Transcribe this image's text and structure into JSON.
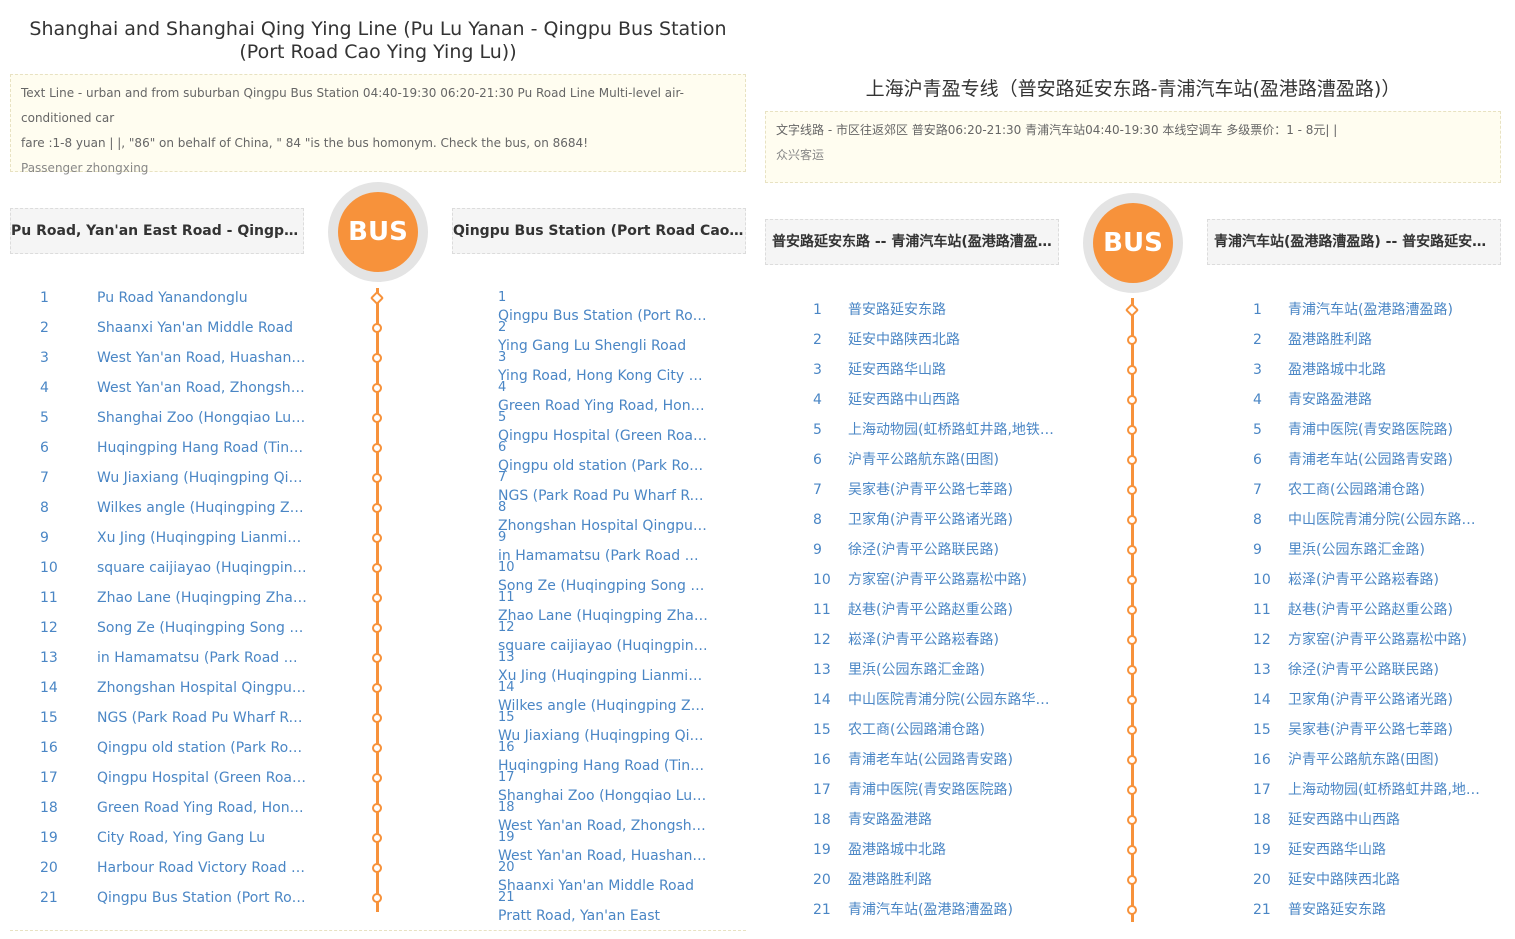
{
  "left": {
    "title": "Shanghai and Shanghai Qing Ying Line (Pu Lu Yanan - Qingpu Bus Station (Port Road Cao Ying Ying Lu))",
    "notice_line1": "Text Line - urban and from suburban Qingpu Bus Station 04:40-19:30 06:20-21:30 Pu Road Line Multi-level air-conditioned car",
    "notice_line2": "fare :1-8 yuan | |, \"86\" on behalf of China, \" 84 \"is the bus homonym.      Check the bus, on 8684!",
    "passenger": "Passenger zhongxing",
    "dir_left": "Pu Road, Yan'an East Road - Qingpu Bus Station (Port Road Cao Ying Ying Lu)",
    "dir_right": "Qingpu Bus Station (Port Road Cao Ying Ying Lu) - Pu Road, Yan'an East Road",
    "bus_label": "BUS",
    "stops_forward": [
      "Pu Road Yanandonglu",
      "Shaanxi Yan'an Middle Road",
      "West Yan'an Road, Huashan Road",
      "West Yan'an Road, Zhongshan West Road",
      "Shanghai Zoo (Hongqiao Lu Hongjing Road)",
      "Huqingping Hang Road (Tin Field Map)",
      "Wu Jiaxiang (Huqingping Qixin)",
      "Wilkes angle (Huqingping Zhuguang Road)",
      "Xu Jing (Huqingping Lianmin Road)",
      "square caijiayao (Huqingping Jiasong Road)",
      "Zhao Lane (Huqingping Zhao road)",
      "Song Ze (Huqingping Song Spring Road)",
      "in Hamamatsu (Park Road Huijin Road)",
      "Zhongshan Hospital Qingpu Branch",
      "NGS (Park Road Pu Wharf Road)",
      "Qingpu old station (Park Road Qing An Road)",
      "Qingpu Hospital (Green Road Qing An Road)",
      "Green Road Ying Road, Hong Kong City",
      "City Road, Ying Gang Lu",
      "Harbour Road Victory Road surrounding",
      "Qingpu Bus Station (Port Road Cao Ying Ying Lu)"
    ],
    "stops_reverse": [
      "Qingpu Bus Station (Port Road Cao Ying Ying Lu)",
      "Ying Gang Lu Shengli Road",
      "Ying Road, Hong Kong City North",
      "Green Road Ying Road, Hong Kong City",
      "Qingpu Hospital (Green Road Qing An Road)",
      "Qingpu old station (Park Road Qing An Road)",
      "NGS (Park Road Pu Wharf Road)",
      "Zhongshan Hospital Qingpu Branch",
      "in Hamamatsu (Park Road Huijin Road)",
      "Song Ze (Huqingping Song Spring Road)",
      "Zhao Lane (Huqingping Zhao road)",
      "square caijiayao (Huqingping Jiasong Road)",
      "Xu Jing (Huqingping Lianmin Road)",
      "Wilkes angle (Huqingping Zhuguang Road)",
      "Wu Jiaxiang (Huqingping Qixin)",
      "Huqingping Hang Road (Tin Field Map)",
      "Shanghai Zoo (Hongqiao Lu Hongjing Road)",
      "West Yan'an Road, Zhongshan West Road",
      "West Yan'an Road, Huashan Road",
      "Shaanxi Yan'an Middle Road",
      "Pratt Road, Yan'an East"
    ]
  },
  "right": {
    "title": "上海沪青盈专线（普安路延安东路-青浦汽车站(盈港路漕盈路)）",
    "notice_line1": "文字线路 - 市区往返郊区 普安路06:20-21:30 青浦汽车站04:40-19:30 本线空调车 多级票价：1 - 8元| |",
    "passenger": "众兴客运",
    "dir_left": "普安路延安东路 -- 青浦汽车站(盈港路漕盈路)",
    "dir_right": "青浦汽车站(盈港路漕盈路) -- 普安路延安东路",
    "bus_label": "BUS",
    "stops_forward": [
      "普安路延安东路",
      "延安中路陕西北路",
      "延安西路华山路",
      "延安西路中山西路",
      "上海动物园(虹桥路虹井路,地铁10号线)",
      "沪青平公路航东路(田图)",
      "吴家巷(沪青平公路七莘路)",
      "卫家角(沪青平公路诸光路)",
      "徐泾(沪青平公路联民路)",
      "方家窑(沪青平公路嘉松中路)",
      "赵巷(沪青平公路赵重公路)",
      "崧泽(沪青平公路崧春路)",
      "里浜(公园东路汇金路)",
      "中山医院青浦分院(公园东路华浦路)",
      "农工商(公园路浦仓路)",
      "青浦老车站(公园路青安路)",
      "青浦中医院(青安路医院路)",
      "青安路盈港路",
      "盈港路城中北路",
      "盈港路胜利路",
      "青浦汽车站(盈港路漕盈路)"
    ],
    "stops_reverse": [
      "青浦汽车站(盈港路漕盈路)",
      "盈港路胜利路",
      "盈港路城中北路",
      "青安路盈港路",
      "青浦中医院(青安路医院路)",
      "青浦老车站(公园路青安路)",
      "农工商(公园路浦仓路)",
      "中山医院青浦分院(公园东路华浦路)",
      "里浜(公园东路汇金路)",
      "崧泽(沪青平公路崧春路)",
      "赵巷(沪青平公路赵重公路)",
      "方家窑(沪青平公路嘉松中路)",
      "徐泾(沪青平公路联民路)",
      "卫家角(沪青平公路诸光路)",
      "吴家巷(沪青平公路七莘路)",
      "沪青平公路航东路(田图)",
      "上海动物园(虹桥路虹井路,地铁10号线)",
      "延安西路中山西路",
      "延安西路华山路",
      "延安中路陕西北路",
      "普安路延安东路"
    ]
  },
  "colors": {
    "accent": "#f7923b",
    "link": "#4a86c5",
    "notice_bg": "#fffdf0"
  }
}
